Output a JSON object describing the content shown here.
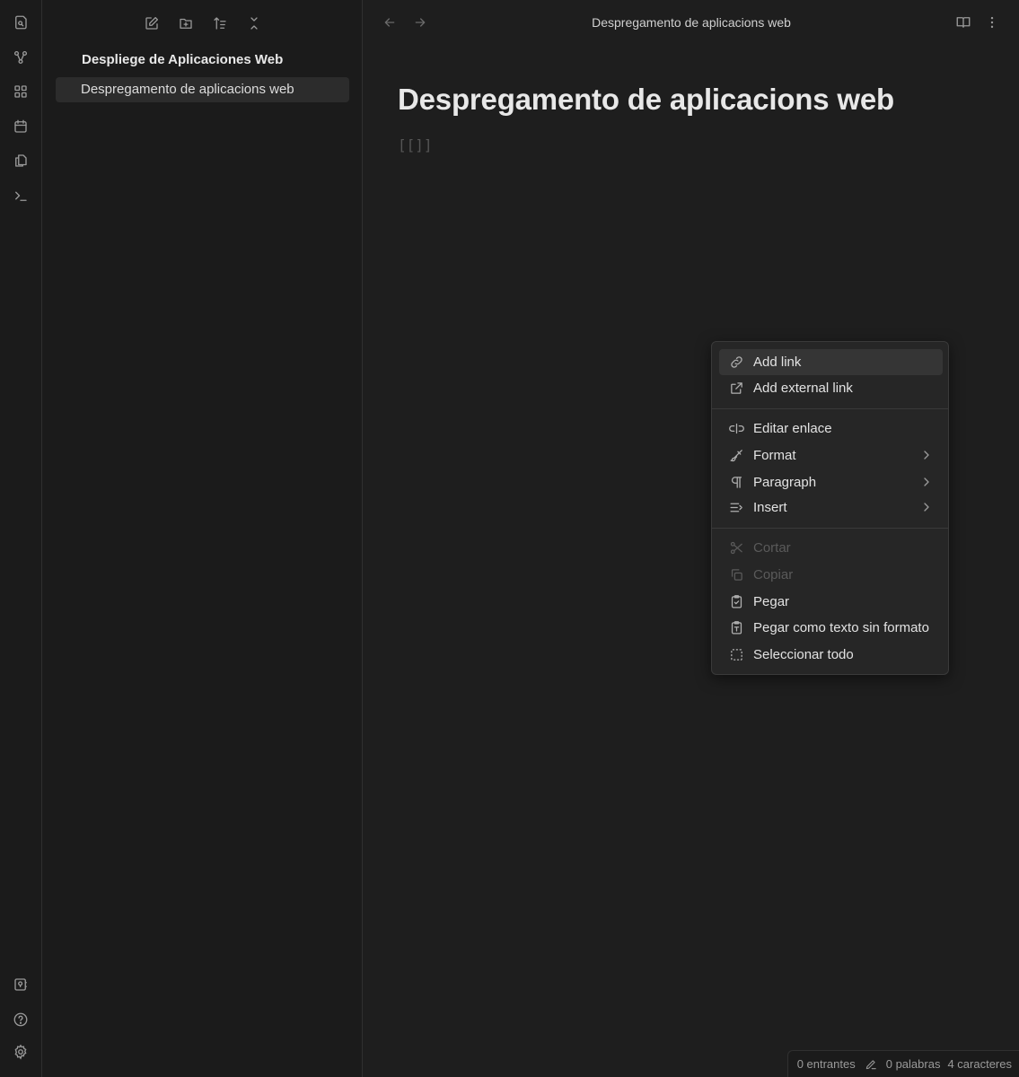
{
  "sidebar": {
    "vault_name": "Despliege de Aplicaciones Web",
    "files": [
      {
        "name": "Despregamento de aplicacions web",
        "active": true
      }
    ]
  },
  "tab": {
    "title": "Despregamento de aplicacions web"
  },
  "document": {
    "title": "Despregamento de aplicacions web",
    "body": "[[]]"
  },
  "context_menu": {
    "groups": [
      [
        {
          "label": "Add link",
          "icon": "link-icon",
          "highlighted": true
        },
        {
          "label": "Add external link",
          "icon": "external-link-icon"
        }
      ],
      [
        {
          "label": "Editar enlace",
          "icon": "edit-link-icon"
        },
        {
          "label": "Format",
          "icon": "brush-icon",
          "submenu": true
        },
        {
          "label": "Paragraph",
          "icon": "pilcrow-icon",
          "submenu": true
        },
        {
          "label": "Insert",
          "icon": "insert-icon",
          "submenu": true
        }
      ],
      [
        {
          "label": "Cortar",
          "icon": "scissors-icon",
          "disabled": true
        },
        {
          "label": "Copiar",
          "icon": "copy-icon",
          "disabled": true
        },
        {
          "label": "Pegar",
          "icon": "clipboard-check-icon"
        },
        {
          "label": "Pegar como texto sin formato",
          "icon": "clipboard-text-icon"
        },
        {
          "label": "Seleccionar todo",
          "icon": "select-all-icon"
        }
      ]
    ]
  },
  "status_bar": {
    "backlinks": "0 entrantes",
    "words": "0 palabras",
    "characters": "4 caracteres"
  }
}
